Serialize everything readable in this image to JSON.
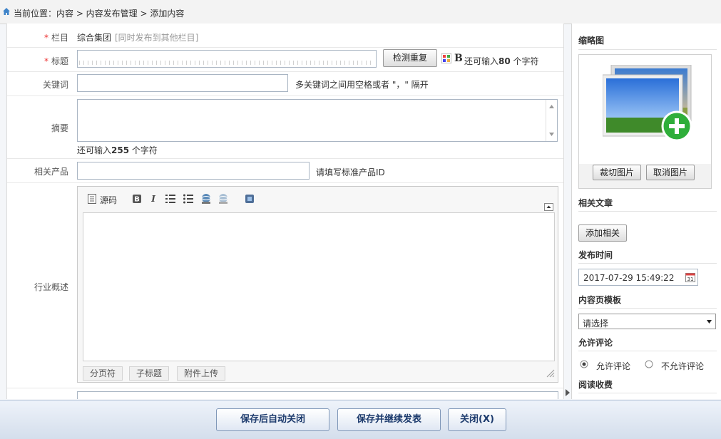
{
  "breadcrumb": {
    "text": "当前位置：内容 > 内容发布管理 > 添加内容"
  },
  "form": {
    "column": {
      "label": "栏目",
      "value": "综合集团",
      "extra": "[同时发布到其他栏目]"
    },
    "title": {
      "label": "标题",
      "check_button": "检测重复",
      "bold_icon": "B",
      "remaining_prefix": "还可输入",
      "remaining_count": "80",
      "remaining_suffix": "个字符"
    },
    "keywords": {
      "label": "关键词",
      "hint": "多关键词之间用空格或者 \"，\" 隔开"
    },
    "summary": {
      "label": "摘要",
      "remaining_prefix": "还可输入",
      "remaining_count": "255",
      "remaining_suffix": "个字符"
    },
    "product": {
      "label": "相关产品",
      "hint": "请填写标准产品ID"
    },
    "overview": {
      "label": "行业概述"
    }
  },
  "editor": {
    "source_label": "源码",
    "footer_buttons": [
      "分页符",
      "子标题",
      "附件上传"
    ]
  },
  "sidebar": {
    "thumb_title": "缩略图",
    "crop_button": "裁切图片",
    "cancel_button": "取消图片",
    "related_title": "相关文章",
    "add_related_button": "添加相关",
    "publish_time_title": "发布时间",
    "publish_time_value": "2017-07-29 15:49:22",
    "template_title": "内容页模板",
    "template_selected": "请选择",
    "comment_title": "允许评论",
    "comment_allow": "允许评论",
    "comment_deny": "不允许评论",
    "reading_fee_title": "阅读收费"
  },
  "footer": {
    "save_close": "保存后自动关闭",
    "save_continue": "保存并继续发表",
    "close": "关闭(X)"
  },
  "colors": {
    "accent_blue": "#1e3c6e",
    "required_red": "#e33333",
    "footer_bg": "#dfe7f3"
  }
}
